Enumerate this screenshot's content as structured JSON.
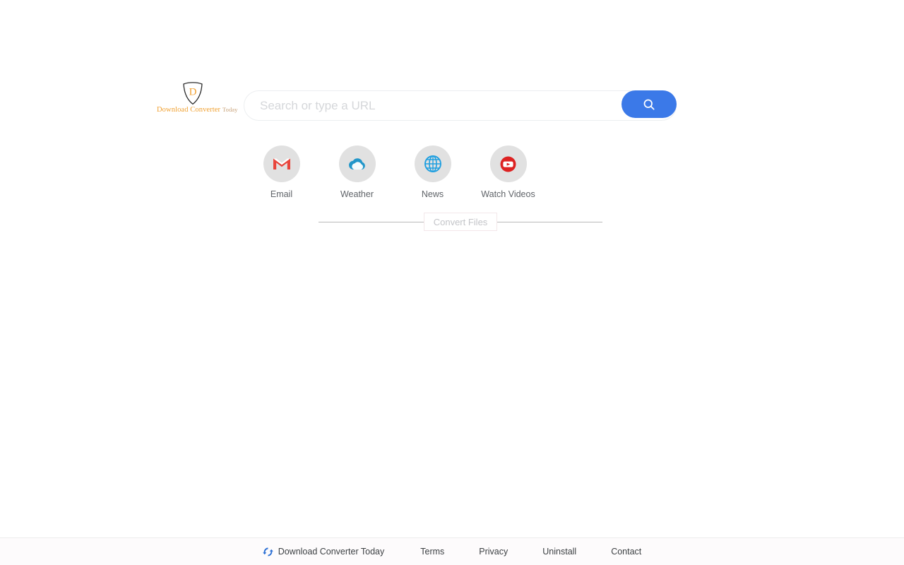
{
  "brand": {
    "badge_letter": "D",
    "name_main": "Download Converter",
    "name_sub": "Today",
    "accent_color": "#f0a030"
  },
  "search": {
    "placeholder": "Search or type a URL",
    "value": "",
    "button_icon": "search-icon",
    "button_color": "#3b79e8"
  },
  "shortcuts": [
    {
      "label": "Email",
      "icon": "gmail-icon"
    },
    {
      "label": "Weather",
      "icon": "cloud-icon"
    },
    {
      "label": "News",
      "icon": "globe-icon"
    },
    {
      "label": "Watch Videos",
      "icon": "youtube-icon"
    }
  ],
  "convert": {
    "label": "Convert Files"
  },
  "footer": {
    "icon": "convert-arrows-icon",
    "brand_label": "Download Converter Today",
    "links": [
      {
        "label": "Terms"
      },
      {
        "label": "Privacy"
      },
      {
        "label": "Uninstall"
      },
      {
        "label": "Contact"
      }
    ]
  }
}
